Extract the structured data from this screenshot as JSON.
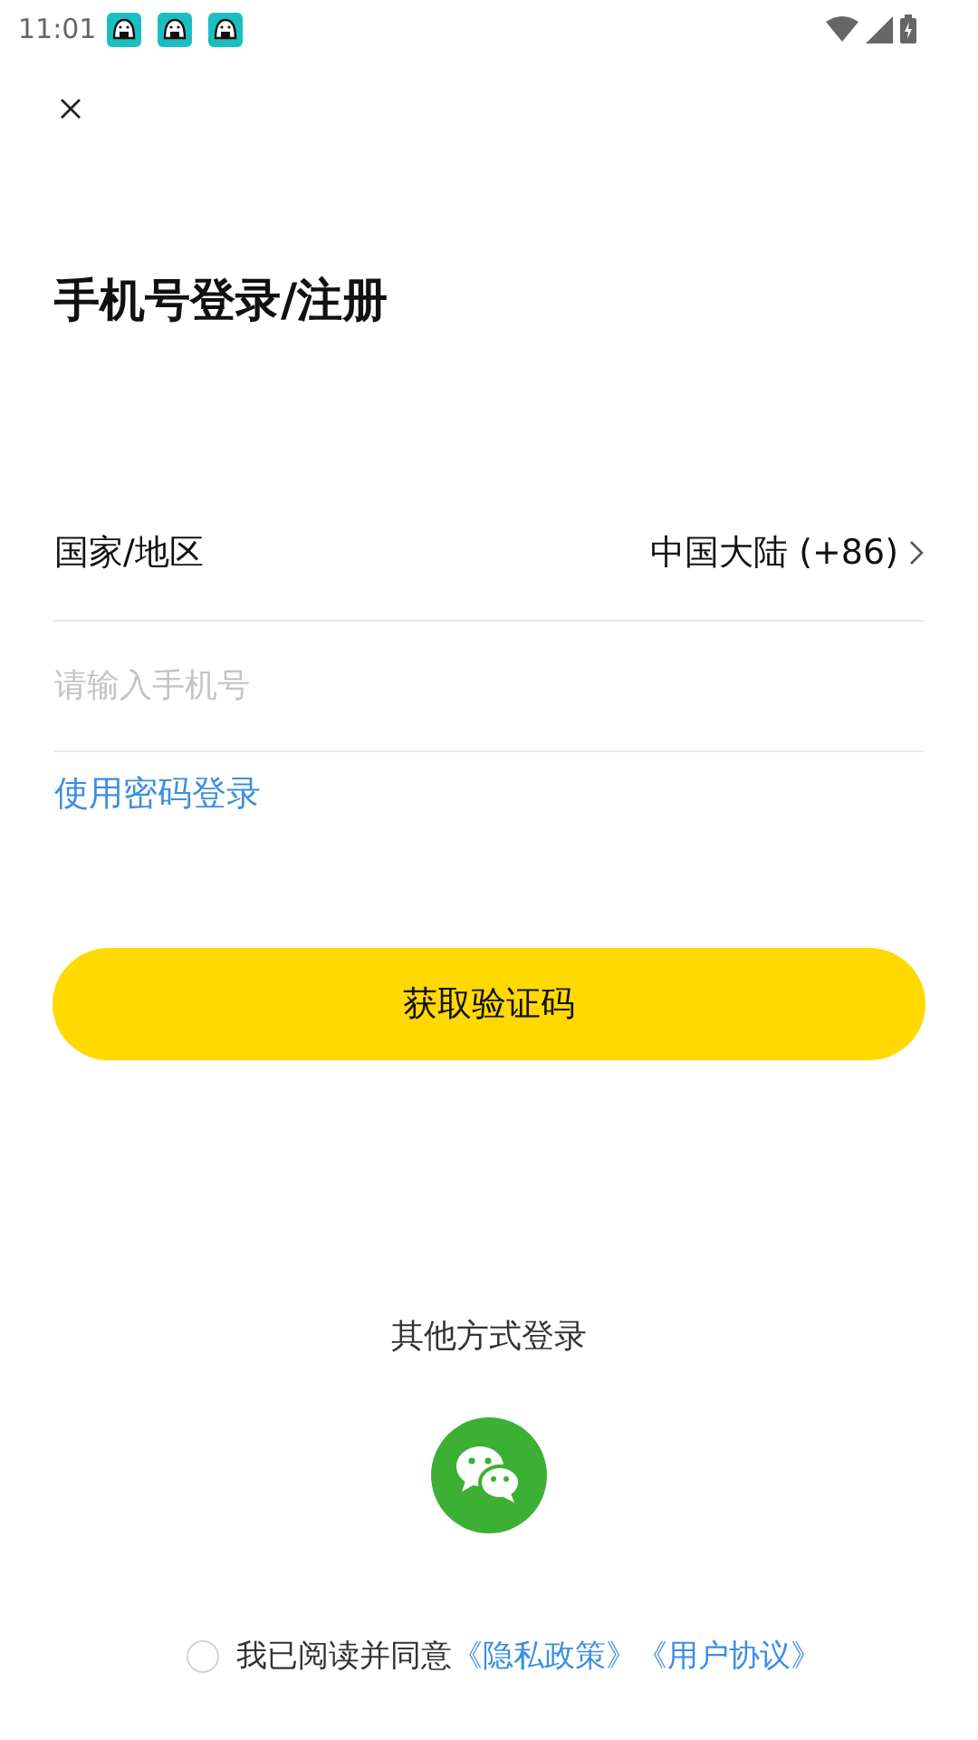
{
  "status_bar": {
    "time": "11:01",
    "notifications": [
      {
        "kind": "app"
      },
      {
        "kind": "app"
      },
      {
        "kind": "app"
      }
    ]
  },
  "title": "手机号登录/注册",
  "country": {
    "label": "国家/地区",
    "value": "中国大陆 (+86)"
  },
  "phone_field": {
    "placeholder": "请输入手机号"
  },
  "password_login_link": "使用密码登录",
  "get_code_button": "获取验证码",
  "other_login": {
    "label": "其他方式登录"
  },
  "agreement": {
    "checked": false,
    "text": "我已阅读并同意",
    "links": [
      "《隐私政策》",
      "《用户协议》"
    ]
  }
}
